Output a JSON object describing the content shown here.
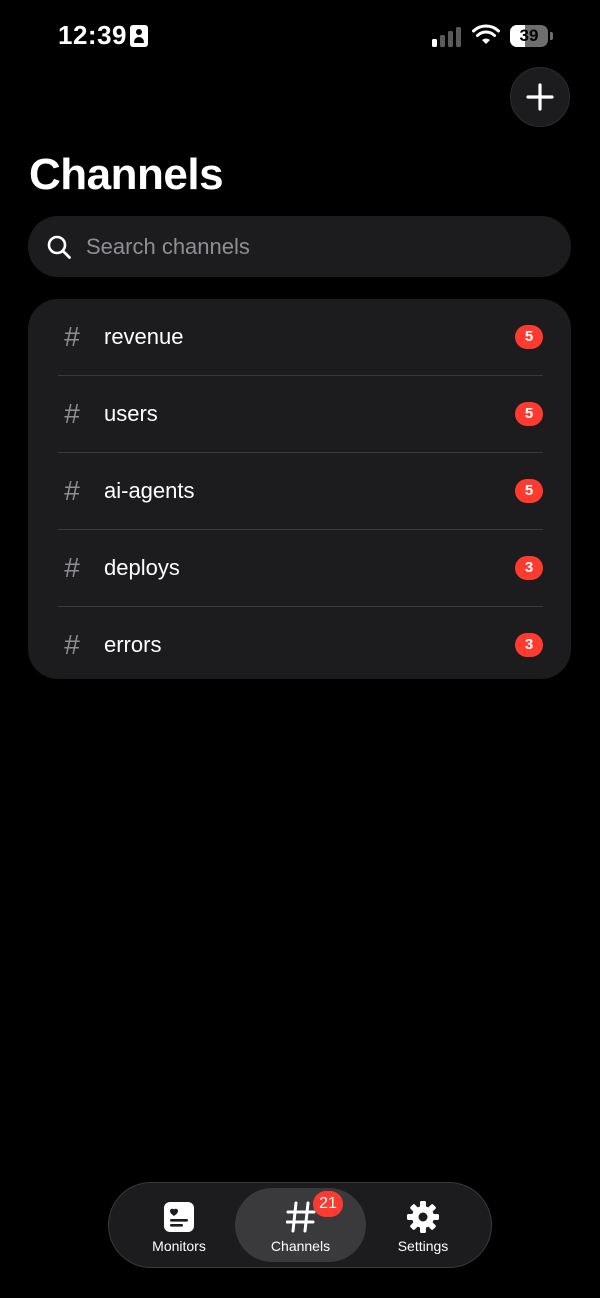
{
  "status_bar": {
    "time": "12:39",
    "battery_level": "39",
    "battery_fraction": 0.39,
    "signal_bars_active": 1,
    "signal_bars_total": 4
  },
  "header": {
    "title": "Channels",
    "add_icon": "plus-icon"
  },
  "search": {
    "placeholder": "Search channels",
    "value": "",
    "icon": "search-icon"
  },
  "channels": [
    {
      "name": "revenue",
      "badge": "5"
    },
    {
      "name": "users",
      "badge": "5"
    },
    {
      "name": "ai-agents",
      "badge": "5"
    },
    {
      "name": "deploys",
      "badge": "3"
    },
    {
      "name": "errors",
      "badge": "3"
    }
  ],
  "channel_prefix": "#",
  "tab_bar": {
    "tabs": [
      {
        "label": "Monitors",
        "icon": "monitor-card-icon",
        "selected": false
      },
      {
        "label": "Channels",
        "icon": "hash-icon",
        "selected": true,
        "badge": "21"
      },
      {
        "label": "Settings",
        "icon": "gear-icon",
        "selected": false
      }
    ]
  },
  "colors": {
    "background": "#000000",
    "surface": "#1c1c1e",
    "badge": "#ff3b30",
    "secondary_text": "#8e8e93",
    "selected_tab": "#3a3a3c"
  }
}
